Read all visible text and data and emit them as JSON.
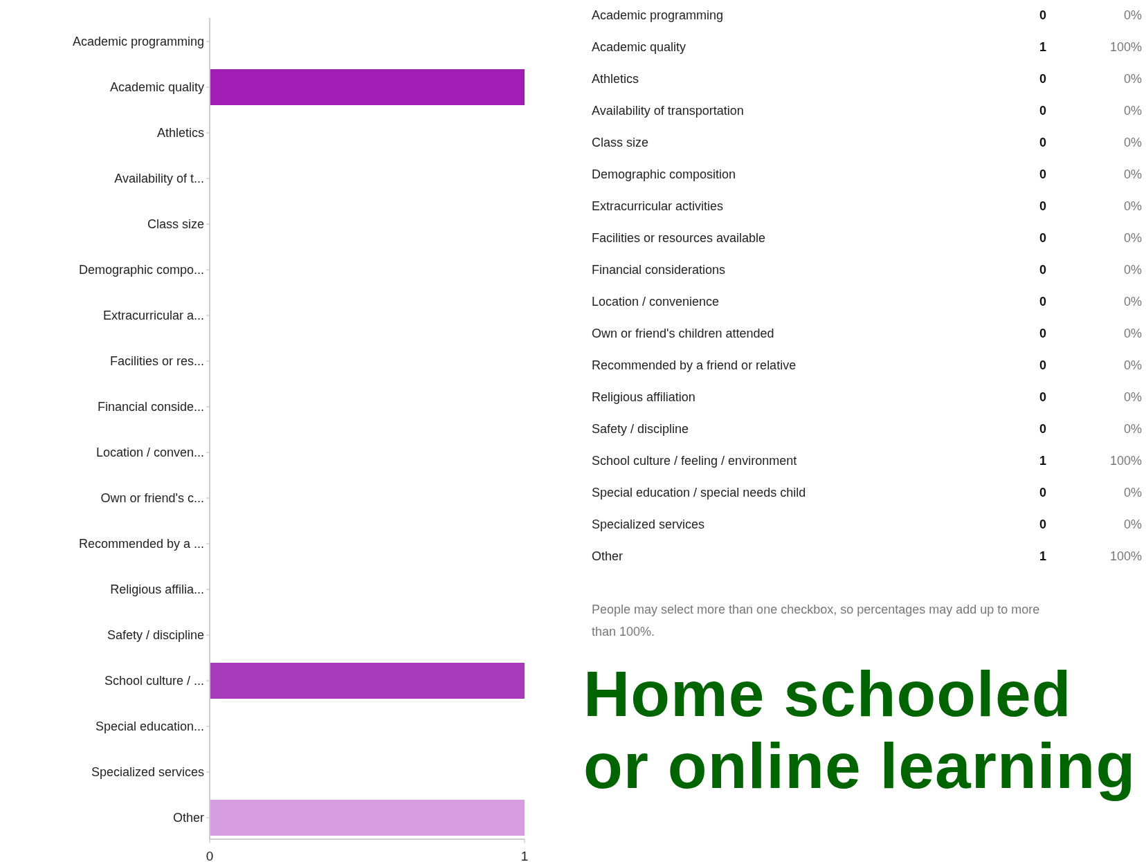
{
  "chart": {
    "chart_data": {
      "type": "bar",
      "orientation": "horizontal",
      "categories": [
        "Academic programming",
        "Academic quality",
        "Athletics",
        "Availability of t...",
        "Class size",
        "Demographic compo...",
        "Extracurricular a...",
        "Facilities or res...",
        "Financial conside...",
        "Location / conven...",
        "Own or friend's c...",
        "Recommended by a ...",
        "Religious affilia...",
        "Safety / discipline",
        "School culture / ...",
        "Special education...",
        "Specialized services",
        "Other"
      ],
      "series": [
        {
          "color": "#a21db6",
          "values": [
            0,
            1,
            0,
            0,
            0,
            0,
            0,
            0,
            0,
            0,
            0,
            0,
            0,
            0,
            0,
            0,
            0,
            0
          ]
        },
        {
          "color": "#a73ab9",
          "values": [
            0,
            0,
            0,
            0,
            0,
            0,
            0,
            0,
            0,
            0,
            0,
            0,
            0,
            0,
            1,
            0,
            0,
            0
          ]
        },
        {
          "color": "#d69de0",
          "values": [
            0,
            0,
            0,
            0,
            0,
            0,
            0,
            0,
            0,
            0,
            0,
            0,
            0,
            0,
            0,
            0,
            0,
            1
          ]
        }
      ],
      "xlim": [
        0,
        1
      ],
      "xticks": [
        0,
        1
      ]
    }
  },
  "table": {
    "rows": [
      {
        "label": "Academic programming",
        "count": "0",
        "percent": "0%"
      },
      {
        "label": "Academic quality",
        "count": "1",
        "percent": "100%"
      },
      {
        "label": "Athletics",
        "count": "0",
        "percent": "0%"
      },
      {
        "label": "Availability of transportation",
        "count": "0",
        "percent": "0%"
      },
      {
        "label": "Class size",
        "count": "0",
        "percent": "0%"
      },
      {
        "label": "Demographic composition",
        "count": "0",
        "percent": "0%"
      },
      {
        "label": "Extracurricular activities",
        "count": "0",
        "percent": "0%"
      },
      {
        "label": "Facilities or resources available",
        "count": "0",
        "percent": "0%"
      },
      {
        "label": "Financial considerations",
        "count": "0",
        "percent": "0%"
      },
      {
        "label": "Location / convenience",
        "count": "0",
        "percent": "0%"
      },
      {
        "label": "Own or friend's children attended",
        "count": "0",
        "percent": "0%"
      },
      {
        "label": "Recommended by a friend or relative",
        "count": "0",
        "percent": "0%"
      },
      {
        "label": "Religious affiliation",
        "count": "0",
        "percent": "0%"
      },
      {
        "label": "Safety / discipline",
        "count": "0",
        "percent": "0%"
      },
      {
        "label": "School culture / feeling / environment",
        "count": "1",
        "percent": "100%"
      },
      {
        "label": "Special education / special needs child",
        "count": "0",
        "percent": "0%"
      },
      {
        "label": "Specialized services",
        "count": "0",
        "percent": "0%"
      },
      {
        "label": "Other",
        "count": "1",
        "percent": "100%"
      }
    ]
  },
  "note": "People may select more than one checkbox, so percentages may add up to more than 100%.",
  "heading": [
    "Home schooled",
    "or online learning"
  ]
}
